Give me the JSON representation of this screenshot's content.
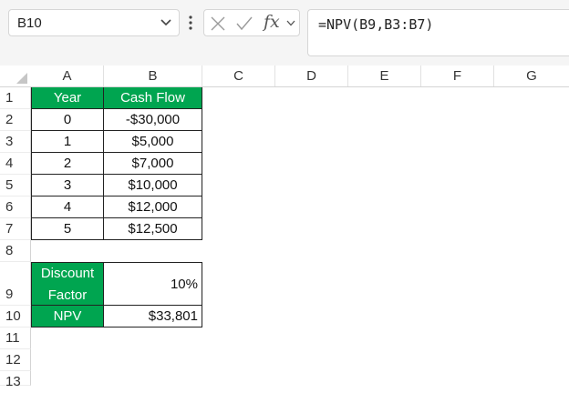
{
  "formula_bar": {
    "name_box": "B10",
    "fx": "fx",
    "formula": "=NPV(B9,B3:B7)"
  },
  "sheet": {
    "columns": [
      "A",
      "B",
      "C",
      "D",
      "E",
      "F",
      "G"
    ],
    "rows": [
      "1",
      "2",
      "3",
      "4",
      "5",
      "6",
      "7",
      "8",
      "9",
      "10",
      "11",
      "12",
      "13"
    ],
    "table": {
      "headers": [
        "Year",
        "Cash Flow"
      ],
      "data": [
        [
          "0",
          "-$30,000"
        ],
        [
          "1",
          "$5,000"
        ],
        [
          "2",
          "$7,000"
        ],
        [
          "3",
          "$10,000"
        ],
        [
          "4",
          "$12,000"
        ],
        [
          "5",
          "$12,500"
        ]
      ]
    },
    "discount": {
      "label_line1": "Discount",
      "label_line2": "Factor",
      "value": "10%"
    },
    "npv": {
      "label": "NPV",
      "value": "$33,801"
    }
  },
  "colors": {
    "header_green": "#00a550",
    "grid": "#e1e1e1"
  }
}
